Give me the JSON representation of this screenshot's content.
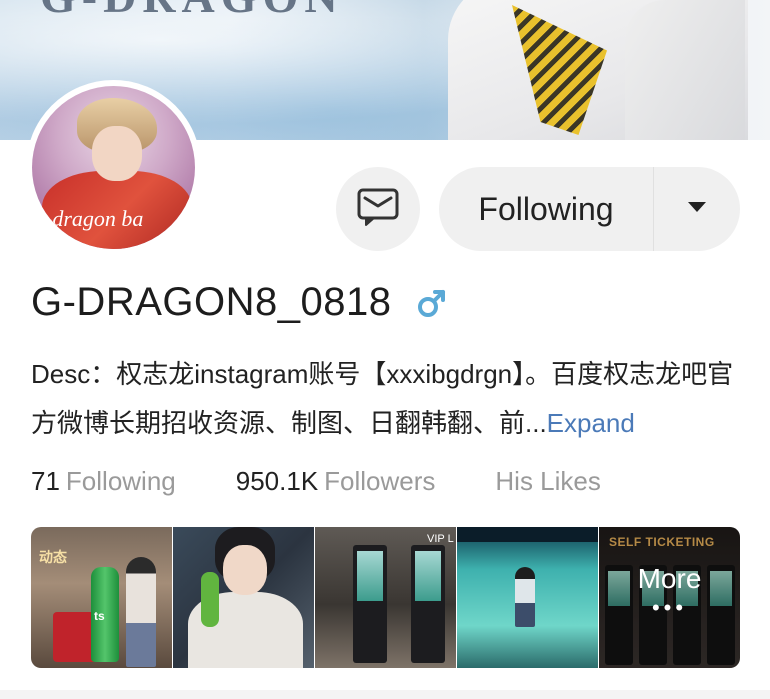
{
  "banner": {
    "title_text": "G-DRAGON"
  },
  "avatar": {
    "overlay_text": "g-dragon ba"
  },
  "actions": {
    "message_icon": "message-envelope-icon",
    "follow_label": "Following",
    "dropdown_icon": "caret-down-icon"
  },
  "profile": {
    "username": "G-DRAGON8_0818",
    "gender_icon": "male-symbol-icon",
    "gender_color": "#5aa9d6",
    "desc_text": "Desc：权志龙instagram账号【xxxibgdrgn】。百度权志龙吧官方微博长期招收资源、制图、日翻韩翻、前...",
    "expand_label": "Expand",
    "expand_color": "#4b7ab8"
  },
  "stats": {
    "following_count": "71",
    "following_label": "Following",
    "followers_count": "950.1K",
    "followers_label": "Followers",
    "likes_label": "His Likes"
  },
  "thumbnails": {
    "thumb1_text": "ts",
    "thumb1_sign": "动态",
    "thumb3_text": "VIP L",
    "thumb5_sign": "SELF TICKETING",
    "more_label": "More",
    "more_dots": "•••"
  }
}
